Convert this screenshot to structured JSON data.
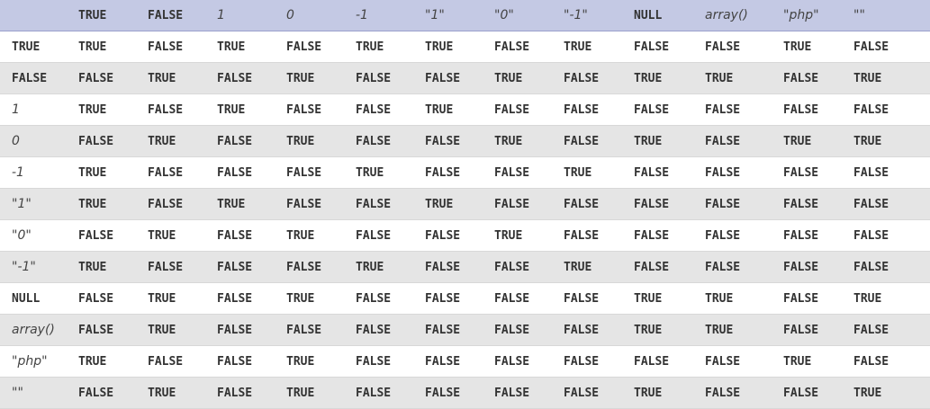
{
  "headers": [
    "",
    "TRUE",
    "FALSE",
    "1",
    "0",
    "-1",
    "\"1\"",
    "\"0\"",
    "\"-1\"",
    "NULL",
    "array()",
    "\"php\"",
    "\"\""
  ],
  "header_italic": [
    false,
    false,
    false,
    true,
    true,
    true,
    true,
    true,
    true,
    false,
    true,
    true,
    true
  ],
  "rows": [
    {
      "label": "TRUE",
      "italic": false,
      "cells": [
        "TRUE",
        "FALSE",
        "TRUE",
        "FALSE",
        "TRUE",
        "TRUE",
        "FALSE",
        "TRUE",
        "FALSE",
        "FALSE",
        "TRUE",
        "FALSE"
      ]
    },
    {
      "label": "FALSE",
      "italic": false,
      "cells": [
        "FALSE",
        "TRUE",
        "FALSE",
        "TRUE",
        "FALSE",
        "FALSE",
        "TRUE",
        "FALSE",
        "TRUE",
        "TRUE",
        "FALSE",
        "TRUE"
      ]
    },
    {
      "label": "1",
      "italic": true,
      "cells": [
        "TRUE",
        "FALSE",
        "TRUE",
        "FALSE",
        "FALSE",
        "TRUE",
        "FALSE",
        "FALSE",
        "FALSE",
        "FALSE",
        "FALSE",
        "FALSE"
      ]
    },
    {
      "label": "0",
      "italic": true,
      "cells": [
        "FALSE",
        "TRUE",
        "FALSE",
        "TRUE",
        "FALSE",
        "FALSE",
        "TRUE",
        "FALSE",
        "TRUE",
        "FALSE",
        "TRUE",
        "TRUE"
      ]
    },
    {
      "label": "-1",
      "italic": true,
      "cells": [
        "TRUE",
        "FALSE",
        "FALSE",
        "FALSE",
        "TRUE",
        "FALSE",
        "FALSE",
        "TRUE",
        "FALSE",
        "FALSE",
        "FALSE",
        "FALSE"
      ]
    },
    {
      "label": "\"1\"",
      "italic": true,
      "cells": [
        "TRUE",
        "FALSE",
        "TRUE",
        "FALSE",
        "FALSE",
        "TRUE",
        "FALSE",
        "FALSE",
        "FALSE",
        "FALSE",
        "FALSE",
        "FALSE"
      ]
    },
    {
      "label": "\"0\"",
      "italic": true,
      "cells": [
        "FALSE",
        "TRUE",
        "FALSE",
        "TRUE",
        "FALSE",
        "FALSE",
        "TRUE",
        "FALSE",
        "FALSE",
        "FALSE",
        "FALSE",
        "FALSE"
      ]
    },
    {
      "label": "\"-1\"",
      "italic": true,
      "cells": [
        "TRUE",
        "FALSE",
        "FALSE",
        "FALSE",
        "TRUE",
        "FALSE",
        "FALSE",
        "TRUE",
        "FALSE",
        "FALSE",
        "FALSE",
        "FALSE"
      ]
    },
    {
      "label": "NULL",
      "italic": false,
      "cells": [
        "FALSE",
        "TRUE",
        "FALSE",
        "TRUE",
        "FALSE",
        "FALSE",
        "FALSE",
        "FALSE",
        "TRUE",
        "TRUE",
        "FALSE",
        "TRUE"
      ]
    },
    {
      "label": "array()",
      "italic": true,
      "cells": [
        "FALSE",
        "TRUE",
        "FALSE",
        "FALSE",
        "FALSE",
        "FALSE",
        "FALSE",
        "FALSE",
        "TRUE",
        "TRUE",
        "FALSE",
        "FALSE"
      ]
    },
    {
      "label": "\"php\"",
      "italic": true,
      "cells": [
        "TRUE",
        "FALSE",
        "FALSE",
        "TRUE",
        "FALSE",
        "FALSE",
        "FALSE",
        "FALSE",
        "FALSE",
        "FALSE",
        "TRUE",
        "FALSE"
      ]
    },
    {
      "label": "\"\"",
      "italic": true,
      "cells": [
        "FALSE",
        "TRUE",
        "FALSE",
        "TRUE",
        "FALSE",
        "FALSE",
        "FALSE",
        "FALSE",
        "TRUE",
        "FALSE",
        "FALSE",
        "TRUE"
      ]
    }
  ]
}
